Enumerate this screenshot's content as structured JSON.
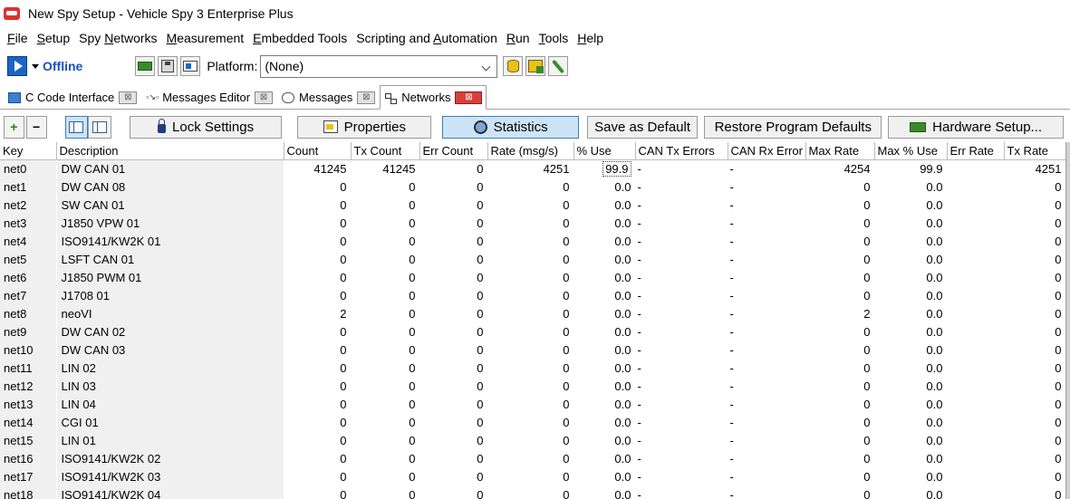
{
  "window": {
    "title": "New Spy Setup - Vehicle Spy 3 Enterprise Plus"
  },
  "menu": [
    {
      "label": "File",
      "accel": "F",
      "rest": "ile"
    },
    {
      "label": "Setup",
      "accel": "S",
      "rest": "etup"
    },
    {
      "label": "Spy Networks",
      "accel": "",
      "pre": "Spy ",
      "ul": "N",
      "rest": "etworks"
    },
    {
      "label": "Measurement",
      "accel": "M",
      "rest": "easurement"
    },
    {
      "label": "Embedded Tools",
      "accel": "E",
      "rest": "mbedded Tools"
    },
    {
      "label": "Scripting and Automation",
      "pre": "Scripting and ",
      "ul": "A",
      "rest": "utomation"
    },
    {
      "label": "Run",
      "accel": "R",
      "rest": "un"
    },
    {
      "label": "Tools",
      "accel": "T",
      "rest": "ools"
    },
    {
      "label": "Help",
      "accel": "H",
      "rest": "elp"
    }
  ],
  "toolbar": {
    "status": "Offline",
    "platform_label": "Platform:",
    "platform_value": "(None)"
  },
  "tabs": [
    {
      "label": "C Code Interface",
      "icon": "c-code-icon",
      "active": false
    },
    {
      "label": "Messages Editor",
      "icon": "messages-editor-icon",
      "active": false
    },
    {
      "label": "Messages",
      "icon": "messages-icon",
      "active": false
    },
    {
      "label": "Networks",
      "icon": "networks-icon",
      "active": true
    }
  ],
  "actions": {
    "add": "+",
    "remove": "−",
    "lock_settings": "Lock Settings",
    "properties": "Properties",
    "statistics": "Statistics",
    "save_default": "Save as Default",
    "restore_defaults": "Restore Program Defaults",
    "hardware_setup": "Hardware Setup..."
  },
  "table": {
    "columns": [
      "Key",
      "Description",
      "Count",
      "Tx Count",
      "Err Count",
      "Rate (msg/s)",
      "% Use",
      "CAN Tx Errors",
      "CAN Rx Error",
      "Max Rate",
      "Max % Use",
      "Err Rate",
      "Tx Rate"
    ],
    "rows": [
      {
        "key": "net0",
        "desc": "DW CAN 01",
        "count": "41245",
        "tx": "41245",
        "err": "0",
        "rate": "4251",
        "use": "99.9",
        "cantx": "-",
        "canrx": "-",
        "maxrate": "4254",
        "maxuse": "99.9",
        "errrate": "",
        "txrate": "4251"
      },
      {
        "key": "net1",
        "desc": "DW CAN 08",
        "count": "0",
        "tx": "0",
        "err": "0",
        "rate": "0",
        "use": "0.0",
        "cantx": "-",
        "canrx": "-",
        "maxrate": "0",
        "maxuse": "0.0",
        "errrate": "",
        "txrate": "0"
      },
      {
        "key": "net2",
        "desc": "SW CAN 01",
        "count": "0",
        "tx": "0",
        "err": "0",
        "rate": "0",
        "use": "0.0",
        "cantx": "-",
        "canrx": "-",
        "maxrate": "0",
        "maxuse": "0.0",
        "errrate": "",
        "txrate": "0"
      },
      {
        "key": "net3",
        "desc": "J1850 VPW 01",
        "count": "0",
        "tx": "0",
        "err": "0",
        "rate": "0",
        "use": "0.0",
        "cantx": "-",
        "canrx": "-",
        "maxrate": "0",
        "maxuse": "0.0",
        "errrate": "",
        "txrate": "0"
      },
      {
        "key": "net4",
        "desc": "ISO9141/KW2K 01",
        "count": "0",
        "tx": "0",
        "err": "0",
        "rate": "0",
        "use": "0.0",
        "cantx": "-",
        "canrx": "-",
        "maxrate": "0",
        "maxuse": "0.0",
        "errrate": "",
        "txrate": "0"
      },
      {
        "key": "net5",
        "desc": "LSFT CAN 01",
        "count": "0",
        "tx": "0",
        "err": "0",
        "rate": "0",
        "use": "0.0",
        "cantx": "-",
        "canrx": "-",
        "maxrate": "0",
        "maxuse": "0.0",
        "errrate": "",
        "txrate": "0"
      },
      {
        "key": "net6",
        "desc": "J1850 PWM 01",
        "count": "0",
        "tx": "0",
        "err": "0",
        "rate": "0",
        "use": "0.0",
        "cantx": "-",
        "canrx": "-",
        "maxrate": "0",
        "maxuse": "0.0",
        "errrate": "",
        "txrate": "0"
      },
      {
        "key": "net7",
        "desc": "J1708 01",
        "count": "0",
        "tx": "0",
        "err": "0",
        "rate": "0",
        "use": "0.0",
        "cantx": "-",
        "canrx": "-",
        "maxrate": "0",
        "maxuse": "0.0",
        "errrate": "",
        "txrate": "0"
      },
      {
        "key": "net8",
        "desc": "neoVI",
        "count": "2",
        "tx": "0",
        "err": "0",
        "rate": "0",
        "use": "0.0",
        "cantx": "-",
        "canrx": "-",
        "maxrate": "2",
        "maxuse": "0.0",
        "errrate": "",
        "txrate": "0"
      },
      {
        "key": "net9",
        "desc": "DW CAN 02",
        "count": "0",
        "tx": "0",
        "err": "0",
        "rate": "0",
        "use": "0.0",
        "cantx": "-",
        "canrx": "-",
        "maxrate": "0",
        "maxuse": "0.0",
        "errrate": "",
        "txrate": "0"
      },
      {
        "key": "net10",
        "desc": "DW CAN 03",
        "count": "0",
        "tx": "0",
        "err": "0",
        "rate": "0",
        "use": "0.0",
        "cantx": "-",
        "canrx": "-",
        "maxrate": "0",
        "maxuse": "0.0",
        "errrate": "",
        "txrate": "0"
      },
      {
        "key": "net11",
        "desc": "LIN 02",
        "count": "0",
        "tx": "0",
        "err": "0",
        "rate": "0",
        "use": "0.0",
        "cantx": "-",
        "canrx": "-",
        "maxrate": "0",
        "maxuse": "0.0",
        "errrate": "",
        "txrate": "0"
      },
      {
        "key": "net12",
        "desc": "LIN 03",
        "count": "0",
        "tx": "0",
        "err": "0",
        "rate": "0",
        "use": "0.0",
        "cantx": "-",
        "canrx": "-",
        "maxrate": "0",
        "maxuse": "0.0",
        "errrate": "",
        "txrate": "0"
      },
      {
        "key": "net13",
        "desc": "LIN 04",
        "count": "0",
        "tx": "0",
        "err": "0",
        "rate": "0",
        "use": "0.0",
        "cantx": "-",
        "canrx": "-",
        "maxrate": "0",
        "maxuse": "0.0",
        "errrate": "",
        "txrate": "0"
      },
      {
        "key": "net14",
        "desc": "CGI 01",
        "count": "0",
        "tx": "0",
        "err": "0",
        "rate": "0",
        "use": "0.0",
        "cantx": "-",
        "canrx": "-",
        "maxrate": "0",
        "maxuse": "0.0",
        "errrate": "",
        "txrate": "0"
      },
      {
        "key": "net15",
        "desc": "LIN 01",
        "count": "0",
        "tx": "0",
        "err": "0",
        "rate": "0",
        "use": "0.0",
        "cantx": "-",
        "canrx": "-",
        "maxrate": "0",
        "maxuse": "0.0",
        "errrate": "",
        "txrate": "0"
      },
      {
        "key": "net16",
        "desc": "ISO9141/KW2K 02",
        "count": "0",
        "tx": "0",
        "err": "0",
        "rate": "0",
        "use": "0.0",
        "cantx": "-",
        "canrx": "-",
        "maxrate": "0",
        "maxuse": "0.0",
        "errrate": "",
        "txrate": "0"
      },
      {
        "key": "net17",
        "desc": "ISO9141/KW2K 03",
        "count": "0",
        "tx": "0",
        "err": "0",
        "rate": "0",
        "use": "0.0",
        "cantx": "-",
        "canrx": "-",
        "maxrate": "0",
        "maxuse": "0.0",
        "errrate": "",
        "txrate": "0"
      },
      {
        "key": "net18",
        "desc": "ISO9141/KW2K 04",
        "count": "0",
        "tx": "0",
        "err": "0",
        "rate": "0",
        "use": "0.0",
        "cantx": "-",
        "canrx": "-",
        "maxrate": "0",
        "maxuse": "0.0",
        "errrate": "",
        "txrate": "0"
      }
    ]
  }
}
